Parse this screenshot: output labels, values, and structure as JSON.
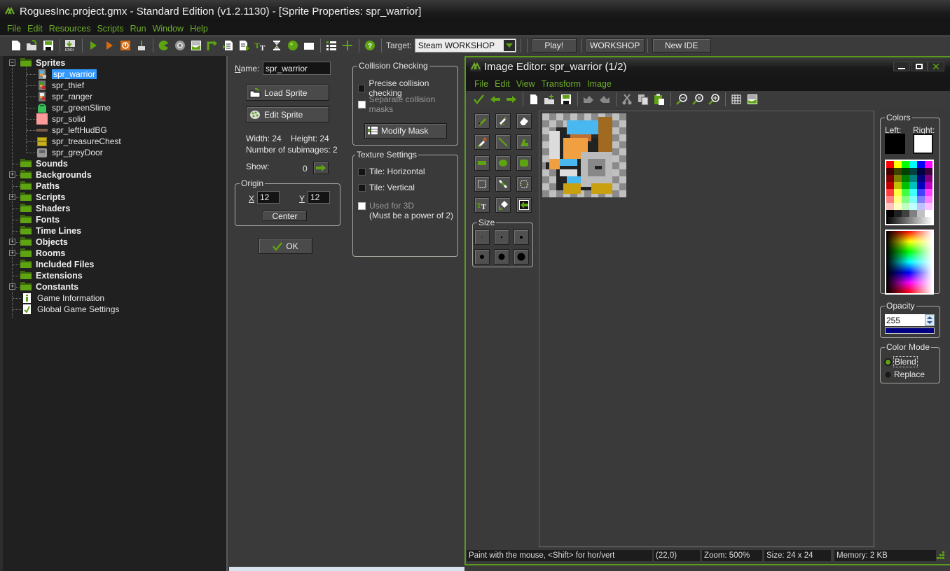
{
  "window": {
    "title": "RoguesInc.project.gmx  -  Standard Edition (v1.2.1130) - [Sprite Properties: spr_warrior]"
  },
  "menu": [
    "File",
    "Edit",
    "Resources",
    "Scripts",
    "Run",
    "Window",
    "Help"
  ],
  "menu_accel": [
    "F",
    "E",
    "R",
    "S",
    "u",
    "W",
    "H"
  ],
  "toolbar": {
    "icons": [
      "new-project-icon",
      "open-project-icon",
      "save-project-icon",
      "export-icon",
      "run-icon",
      "debug-icon",
      "stop-icon",
      "clean-icon",
      "create-sprite-icon",
      "create-sound-icon",
      "create-background-icon",
      "create-path-icon",
      "create-script-icon",
      "create-shader-icon",
      "create-font-icon",
      "create-timeline-icon",
      "create-object-icon",
      "create-room-icon",
      "game-settings-icon",
      "add-extension-icon",
      "help-icon"
    ],
    "target_label": "Target:",
    "target_value": "Steam WORKSHOP",
    "play_label": "Play!",
    "workshop_label": "WORKSHOP",
    "new_ide_label": "New IDE"
  },
  "tree": {
    "sprites_label": "Sprites",
    "sprites": [
      {
        "name": "spr_warrior",
        "selected": true
      },
      {
        "name": "spr_thief"
      },
      {
        "name": "spr_ranger"
      },
      {
        "name": "spr_greenSlime"
      },
      {
        "name": "spr_solid"
      },
      {
        "name": "spr_leftHudBG"
      },
      {
        "name": "spr_treasureChest"
      },
      {
        "name": "spr_greyDoor"
      }
    ],
    "folders": [
      {
        "name": "Sounds",
        "expandable": false
      },
      {
        "name": "Backgrounds",
        "expandable": true
      },
      {
        "name": "Paths",
        "expandable": false
      },
      {
        "name": "Scripts",
        "expandable": true
      },
      {
        "name": "Shaders",
        "expandable": false
      },
      {
        "name": "Fonts",
        "expandable": false
      },
      {
        "name": "Time Lines",
        "expandable": false
      },
      {
        "name": "Objects",
        "expandable": true
      },
      {
        "name": "Rooms",
        "expandable": true
      },
      {
        "name": "Included Files",
        "expandable": false
      },
      {
        "name": "Extensions",
        "expandable": false
      },
      {
        "name": "Constants",
        "expandable": true
      }
    ],
    "game_information": "Game Information",
    "global_settings": "Global Game Settings"
  },
  "sprite_props": {
    "name_label": "Name:",
    "name_value": "spr_warrior",
    "load_sprite": "Load Sprite",
    "edit_sprite": "Edit Sprite",
    "width_text": "Width: 24",
    "height_text": "Height: 24",
    "subimages_text": "Number of subimages: 2",
    "show_label": "Show:",
    "show_value": "0",
    "origin_label": "Origin",
    "x_label": "X",
    "x_value": "12",
    "y_label": "Y",
    "y_value": "12",
    "center_label": "Center",
    "ok_label": "OK",
    "collision_label": "Collision Checking",
    "precise_label": "Precise collision checking",
    "separate_label": "Separate collision masks",
    "modify_mask_label": "Modify Mask",
    "texture_label": "Texture Settings",
    "tile_h_label": "Tile: Horizontal",
    "tile_v_label": "Tile: Vertical",
    "used3d_label": "Used for 3D",
    "used3d_note": "(Must be a power of 2)"
  },
  "image_editor": {
    "title": "Image Editor: spr_warrior (1/2)",
    "menu": [
      "File",
      "Edit",
      "View",
      "Transform",
      "Image"
    ],
    "toolbar_icons": [
      "confirm-icon",
      "previous-icon",
      "next-icon",
      "new-image-icon",
      "open-image-icon",
      "save-image-icon",
      "undo-icon",
      "redo-icon",
      "cut-icon",
      "copy-icon",
      "paste-icon",
      "zoom-out-icon",
      "zoom-reset-icon",
      "zoom-in-icon",
      "grid-icon",
      "image-properties-icon"
    ],
    "tools": [
      "pencil-tool",
      "spray-tool",
      "eraser-tool",
      "color-picker-tool",
      "line-tool",
      "polygon-tool",
      "rectangle-tool",
      "ellipse-tool",
      "rounded-rectangle-tool",
      "selection-tool",
      "magic-wand-tool",
      "spray-select-tool",
      "text-tool",
      "fill-tool",
      "change-color-tool"
    ],
    "size_label": "Size",
    "sizes": [
      1,
      2,
      3,
      4,
      5,
      6
    ],
    "colors_label": "Colors",
    "left_label": "Left:",
    "right_label": "Right:",
    "left_color": "#000000",
    "right_color": "#ffffff",
    "palette": [
      [
        "#ff0000",
        "#ffff00",
        "#00ff00",
        "#00ffff",
        "#0000ff",
        "#ff00ff"
      ],
      [
        "#400000",
        "#404000",
        "#004000",
        "#004040",
        "#000040",
        "#400040"
      ],
      [
        "#800000",
        "#808000",
        "#008000",
        "#008080",
        "#000080",
        "#800080"
      ],
      [
        "#c00000",
        "#c0c000",
        "#00c000",
        "#00c0c0",
        "#0000c0",
        "#c000c0"
      ],
      [
        "#ff4040",
        "#ffff40",
        "#40ff40",
        "#40ffff",
        "#4040ff",
        "#ff40ff"
      ],
      [
        "#ff8080",
        "#ffff80",
        "#80ff80",
        "#80ffff",
        "#8080ff",
        "#ff80ff"
      ],
      [
        "#ffc0c0",
        "#ffffc0",
        "#c0ffc0",
        "#c0ffff",
        "#c0c0ff",
        "#ffc0ff"
      ],
      [
        "#000000",
        "#202020",
        "#404040",
        "#808080",
        "#c0c0c0",
        "#ffffff"
      ]
    ],
    "opacity_label": "Opacity",
    "opacity_value": "255",
    "opacity_color": "#000080",
    "color_mode_label": "Color Mode",
    "blend_label": "Blend",
    "replace_label": "Replace",
    "selected_mode": "Blend",
    "status": {
      "hint": "Paint with the mouse, <Shift> for hor/vert",
      "coords": "(22,0)",
      "zoom": "Zoom: 500%",
      "size": "Size: 24 x 24",
      "memory": "Memory: 2 KB"
    }
  },
  "colors": {
    "accent_green": "#6fae2a",
    "selection_blue": "#3399ff",
    "folder_green": "#5ea412"
  }
}
